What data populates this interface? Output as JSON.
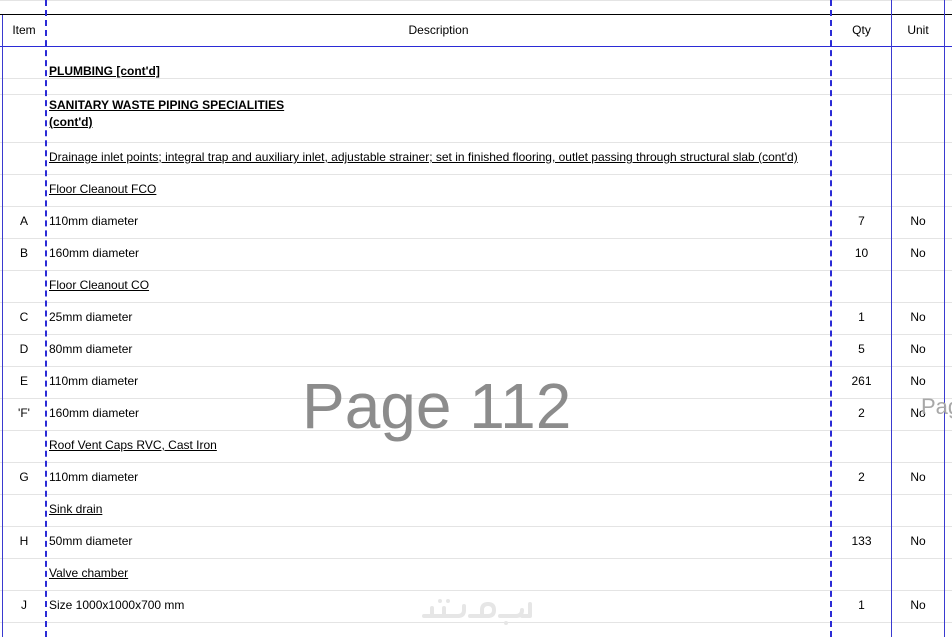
{
  "header": {
    "item": "Item",
    "description": "Description",
    "qty": "Qty",
    "unit": "Unit"
  },
  "section_title": "PLUMBING [cont'd]",
  "subsection_title": {
    "line1": "SANITARY WASTE PIPING SPECIALITIES",
    "line2": "(cont'd)"
  },
  "intro": "Drainage inlet points; integral trap and auxiliary inlet, adjustable strainer; set in finished flooring, outlet passing through structural slab (cont'd)",
  "groups": [
    {
      "title": "Floor Cleanout FCO"
    },
    {
      "title": "Floor Cleanout CO"
    },
    {
      "title": "Roof Vent Caps RVC, Cast Iron"
    },
    {
      "title": "Sink drain"
    },
    {
      "title": "Valve chamber"
    }
  ],
  "items": [
    {
      "item": "A",
      "desc": "110mm diameter",
      "qty": "7",
      "unit": "No"
    },
    {
      "item": "B",
      "desc": "160mm diameter",
      "qty": "10",
      "unit": "No"
    },
    {
      "item": "C",
      "desc": "25mm diameter",
      "qty": "1",
      "unit": "No"
    },
    {
      "item": "D",
      "desc": "80mm diameter",
      "qty": "5",
      "unit": "No"
    },
    {
      "item": "E",
      "desc": "110mm diameter",
      "qty": "261",
      "unit": "No"
    },
    {
      "item": "'F'",
      "desc": "160mm diameter",
      "qty": "2",
      "unit": "No"
    },
    {
      "item": "G",
      "desc": "110mm diameter",
      "qty": "2",
      "unit": "No"
    },
    {
      "item": "H",
      "desc": "50mm diameter",
      "qty": "133",
      "unit": "No"
    },
    {
      "item": "J",
      "desc": "Size 1000x1000x700 mm",
      "qty": "1",
      "unit": "No"
    }
  ],
  "watermark": "Page 112",
  "watermark_edge": "Pag",
  "logo_text": "خمسات",
  "colors": {
    "border": "#2b2bd6",
    "watermark": "#8c8c8c"
  }
}
